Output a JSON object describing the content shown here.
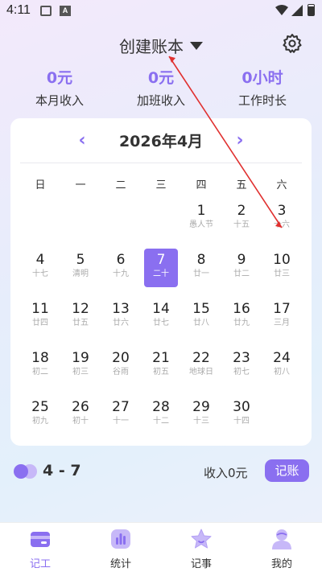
{
  "status_bar": {
    "time": "4:11",
    "notif_letter": "A"
  },
  "header": {
    "title": "创建账本"
  },
  "stats": [
    {
      "value": "0元",
      "label": "本月收入"
    },
    {
      "value": "0元",
      "label": "加班收入"
    },
    {
      "value": "0小时",
      "label": "工作时长"
    }
  ],
  "calendar": {
    "title": "2026年4月",
    "prev": "‹",
    "next": "›",
    "weekdays": [
      "日",
      "一",
      "二",
      "三",
      "四",
      "五",
      "六"
    ],
    "selected_day": "7",
    "days": [
      {
        "n": "1",
        "l": "愚人节"
      },
      {
        "n": "2",
        "l": "十五"
      },
      {
        "n": "3",
        "l": "十六"
      },
      {
        "n": "4",
        "l": "十七"
      },
      {
        "n": "5",
        "l": "清明"
      },
      {
        "n": "6",
        "l": "十九"
      },
      {
        "n": "7",
        "l": "二十"
      },
      {
        "n": "8",
        "l": "廿一"
      },
      {
        "n": "9",
        "l": "廿二"
      },
      {
        "n": "10",
        "l": "廿三"
      },
      {
        "n": "11",
        "l": "廿四"
      },
      {
        "n": "12",
        "l": "廿五"
      },
      {
        "n": "13",
        "l": "廿六"
      },
      {
        "n": "14",
        "l": "廿七"
      },
      {
        "n": "15",
        "l": "廿八"
      },
      {
        "n": "16",
        "l": "廿九"
      },
      {
        "n": "17",
        "l": "三月"
      },
      {
        "n": "18",
        "l": "初二"
      },
      {
        "n": "19",
        "l": "初三"
      },
      {
        "n": "20",
        "l": "谷雨"
      },
      {
        "n": "21",
        "l": "初五"
      },
      {
        "n": "22",
        "l": "地球日"
      },
      {
        "n": "23",
        "l": "初七"
      },
      {
        "n": "24",
        "l": "初八"
      },
      {
        "n": "25",
        "l": "初九"
      },
      {
        "n": "26",
        "l": "初十"
      },
      {
        "n": "27",
        "l": "十一"
      },
      {
        "n": "28",
        "l": "十二"
      },
      {
        "n": "29",
        "l": "十三"
      },
      {
        "n": "30",
        "l": "十四"
      }
    ]
  },
  "summary": {
    "range": "4 - 7",
    "income": "收入0元",
    "button": "记账"
  },
  "tabs": [
    {
      "label": "记工",
      "icon": "card-icon",
      "active": true
    },
    {
      "label": "统计",
      "icon": "chart-icon",
      "active": false
    },
    {
      "label": "记事",
      "icon": "star-icon",
      "active": false
    },
    {
      "label": "我的",
      "icon": "person-icon",
      "active": false
    }
  ],
  "colors": {
    "accent": "#8a6ff0",
    "annotation": "#e0302f"
  }
}
